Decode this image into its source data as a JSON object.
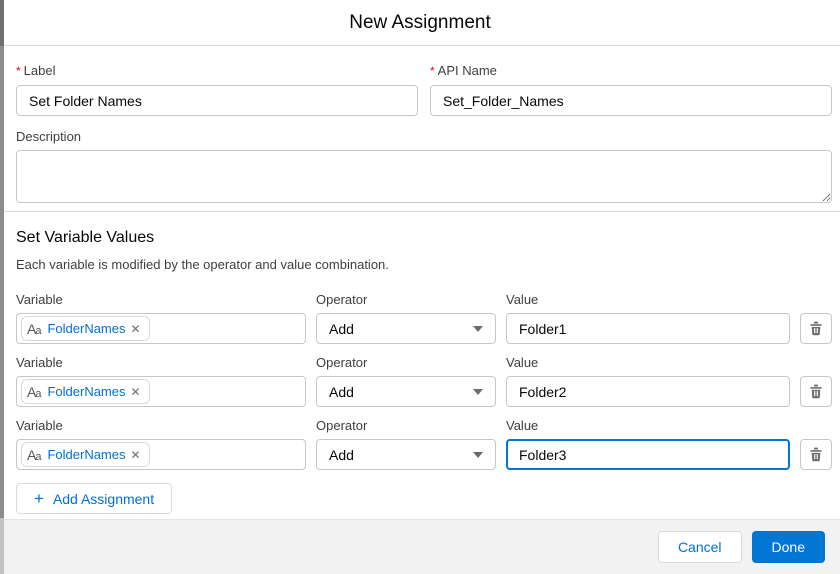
{
  "dialog": {
    "title": "New Assignment",
    "fields": {
      "label": {
        "required": "*",
        "label": "Label",
        "value": "Set Folder Names"
      },
      "api_name": {
        "required": "*",
        "label": "API Name",
        "value": "Set_Folder_Names"
      },
      "description": {
        "label": "Description",
        "value": ""
      }
    },
    "section": {
      "heading": "Set Variable Values",
      "subtext": "Each variable is modified by the operator and value combination."
    },
    "rows": [
      {
        "variable_label": "Variable",
        "pill": "FolderNames",
        "operator_label": "Operator",
        "operator": "Add",
        "value_label": "Value",
        "value": "Folder1"
      },
      {
        "variable_label": "Variable",
        "pill": "FolderNames",
        "operator_label": "Operator",
        "operator": "Add",
        "value_label": "Value",
        "value": "Folder2"
      },
      {
        "variable_label": "Variable",
        "pill": "FolderNames",
        "operator_label": "Operator",
        "operator": "Add",
        "value_label": "Value",
        "value": "Folder3"
      }
    ],
    "icons": {
      "pill_type_big": "A",
      "pill_type_small": "a",
      "pill_remove": "✕",
      "add_plus": "+"
    },
    "add_button_label": "Add Assignment",
    "footer": {
      "cancel_label": "Cancel",
      "done_label": "Done"
    },
    "colors": {
      "accent_blue": "#0070d2",
      "done_button_bg": "#0176d3",
      "required_red": "#ea001e",
      "border_gray": "#dddbda",
      "footer_bg": "#f3f2f2"
    }
  }
}
